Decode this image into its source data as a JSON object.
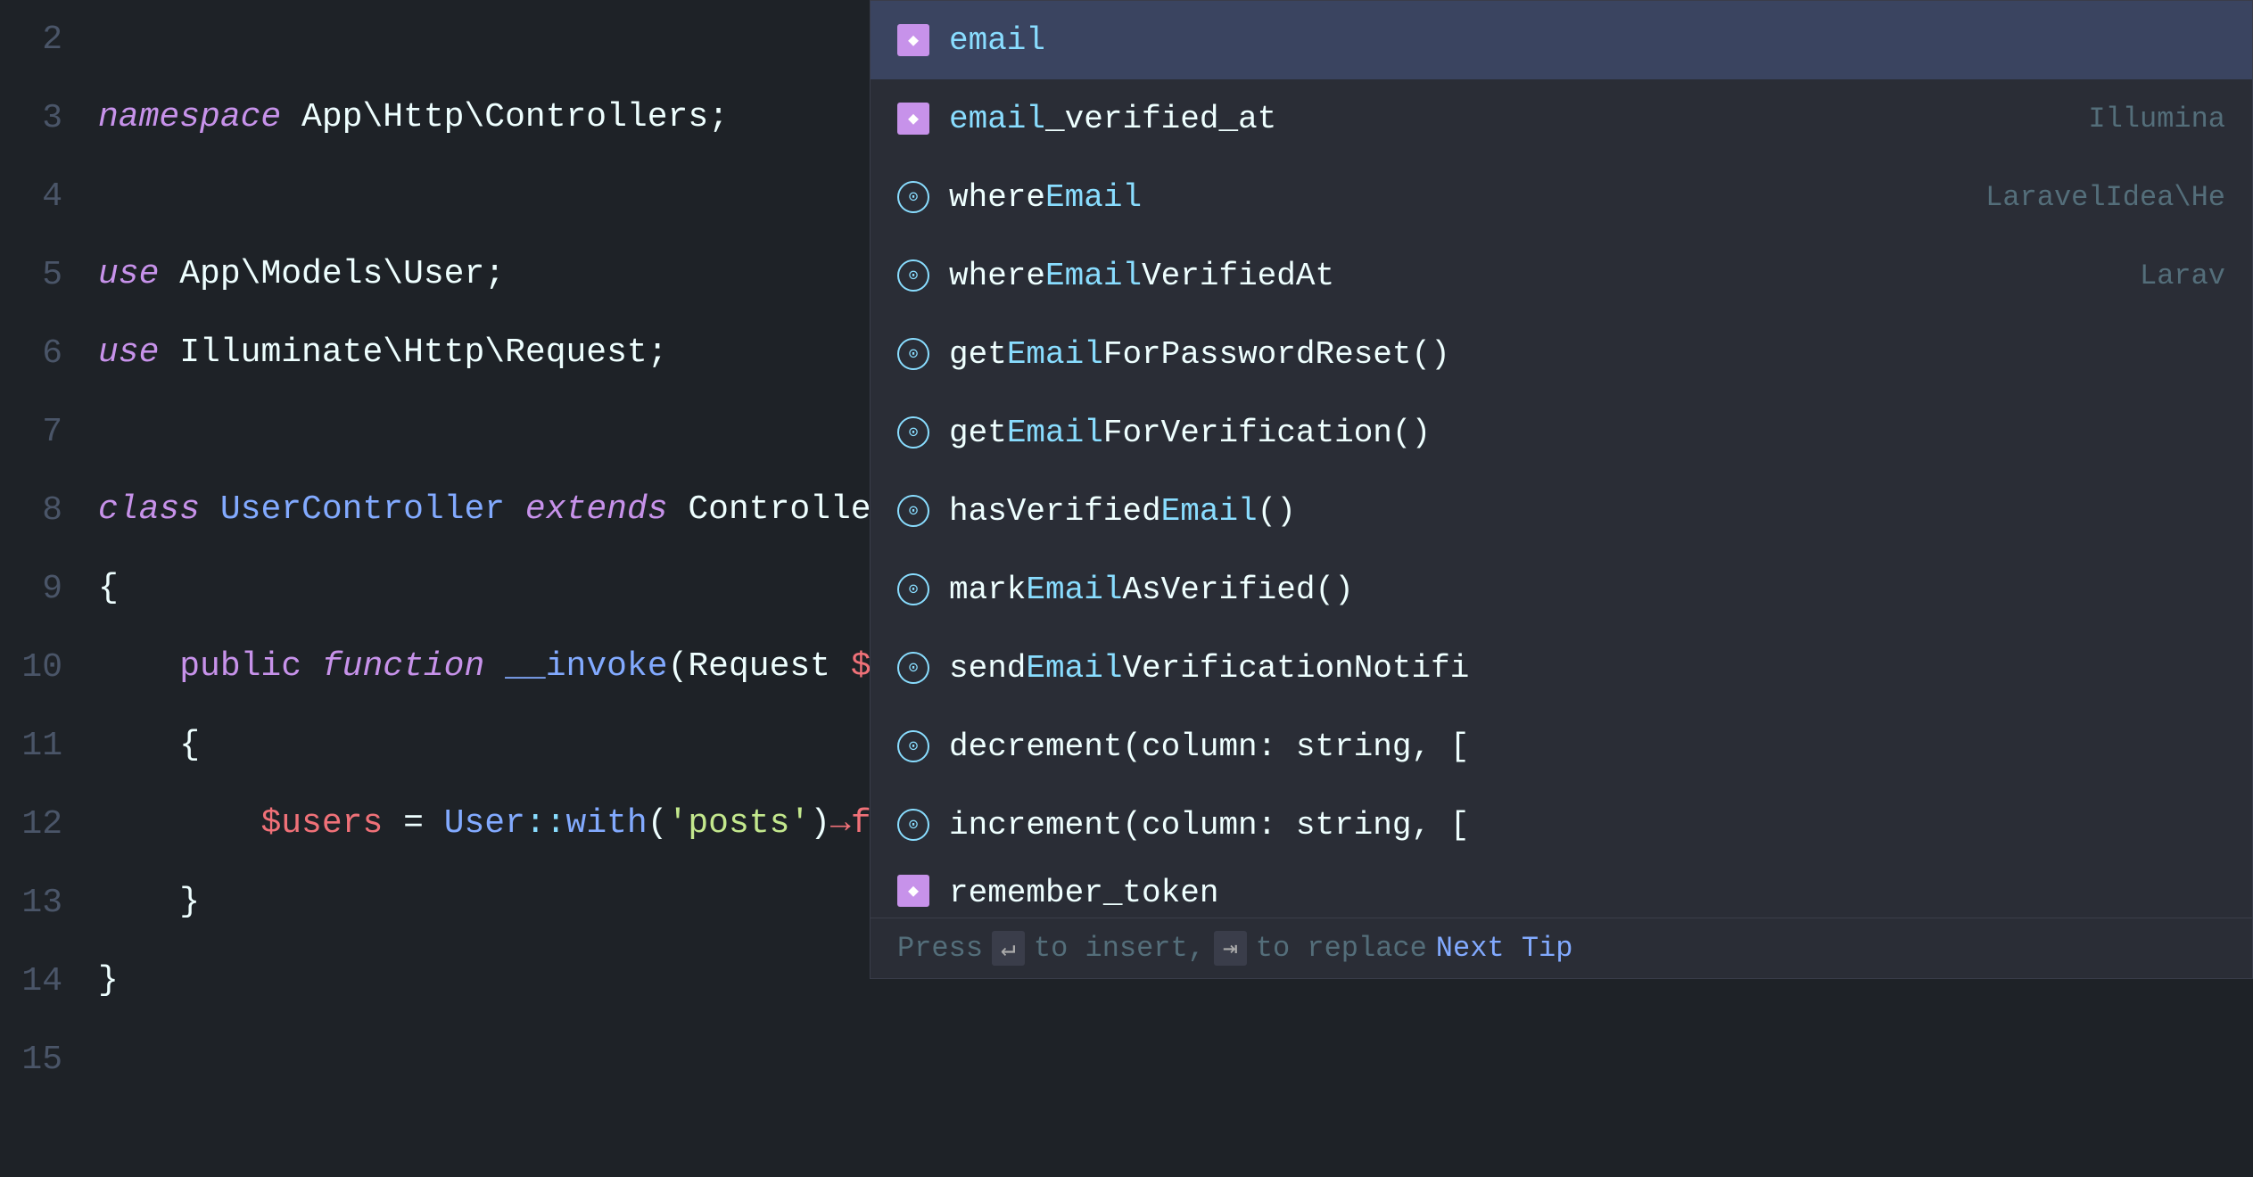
{
  "editor": {
    "background": "#1e2227",
    "lines": [
      {
        "number": "2",
        "content": ""
      },
      {
        "number": "3",
        "content": "namespace App\\Http\\Controllers;"
      },
      {
        "number": "4",
        "content": ""
      },
      {
        "number": "5",
        "content": "use App\\Models\\User;"
      },
      {
        "number": "6",
        "content": "use Illuminate\\Http\\Request;"
      },
      {
        "number": "7",
        "content": ""
      },
      {
        "number": "8",
        "content": "class UserController extends Controller"
      },
      {
        "number": "9",
        "content": "{"
      },
      {
        "number": "10",
        "content": "    public function __invoke(Request $request)"
      },
      {
        "number": "11",
        "content": "    {"
      },
      {
        "number": "12",
        "content": "        $users = User::with('posts')->firstOrFail()->em"
      },
      {
        "number": "13",
        "content": "    }"
      },
      {
        "number": "14",
        "content": "}"
      },
      {
        "number": "15",
        "content": ""
      }
    ]
  },
  "autocomplete": {
    "items": [
      {
        "icon_type": "field",
        "name": "email",
        "highlight": "email",
        "source": "",
        "selected": true
      },
      {
        "icon_type": "field",
        "name": "email_verified_at",
        "highlight": "email",
        "source": "Illumina",
        "selected": false
      },
      {
        "icon_type": "method",
        "name": "whereEmail",
        "highlight": "Email",
        "source": "LaravelIdea\\He",
        "selected": false
      },
      {
        "icon_type": "method",
        "name": "whereEmailVerifiedAt",
        "highlight": "Email",
        "source": "Larav",
        "selected": false
      },
      {
        "icon_type": "method",
        "name": "getEmailForPasswordReset()",
        "highlight": "Email",
        "source": "",
        "selected": false
      },
      {
        "icon_type": "method",
        "name": "getEmailForVerification()",
        "highlight": "Email",
        "source": "",
        "selected": false
      },
      {
        "icon_type": "method",
        "name": "hasVerifiedEmail()",
        "highlight": "Email",
        "source": "",
        "selected": false
      },
      {
        "icon_type": "method",
        "name": "markEmailAsVerified()",
        "highlight": "Email",
        "source": "",
        "selected": false
      },
      {
        "icon_type": "method",
        "name": "sendEmailVerificationNotifi",
        "highlight": "Email",
        "source": "",
        "selected": false
      },
      {
        "icon_type": "method",
        "name": "decrement(column: string, [",
        "highlight": "",
        "source": "",
        "selected": false
      },
      {
        "icon_type": "method",
        "name": "increment(column: string, [",
        "highlight": "",
        "source": "",
        "selected": false
      },
      {
        "icon_type": "field",
        "name": "remember_token",
        "highlight": "",
        "source": "",
        "selected": false,
        "partial": true
      }
    ],
    "footer": {
      "press_text": "Press",
      "enter_hint": "↵",
      "to_insert": "to insert,",
      "tab_hint": "⇥",
      "to_replace": "to replace",
      "next_tip_label": "Next Tip"
    }
  }
}
